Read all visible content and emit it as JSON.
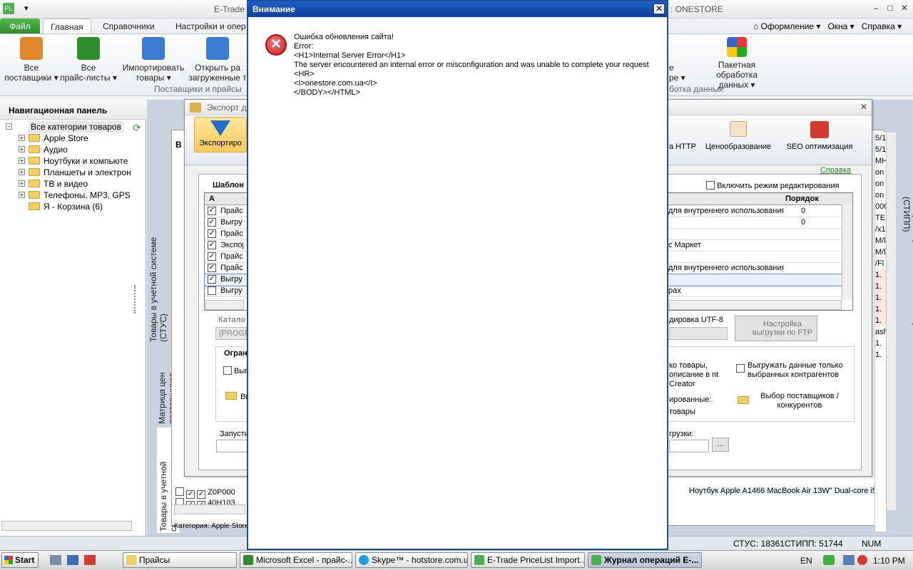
{
  "app": {
    "title_left": "E-Trade P",
    "title_right": ": ONESTORE",
    "win_min": "–",
    "win_max": "□",
    "win_close": "✕"
  },
  "ribbon": {
    "file_tab": "Файл",
    "tabs": [
      "Главная",
      "Справочники",
      "Настройки и опер"
    ],
    "right_menu": [
      "Оформление",
      "Окна",
      "Справка"
    ],
    "buttons": [
      {
        "label1": "Все",
        "label2": "поставщики ▾",
        "icon": "truck-icon",
        "color": "#e0862a"
      },
      {
        "label1": "Все",
        "label2": "прайс-листы ▾",
        "icon": "excel-icon",
        "color": "#2f8b2b"
      },
      {
        "label1": "Импортировать",
        "label2": "товары ▾",
        "icon": "import-icon",
        "color": "#3a7bd5"
      },
      {
        "label1": "Открыть ра",
        "label2": "загруженные т",
        "icon": "open-import-icon",
        "color": "#3a7bd5"
      }
    ],
    "group_left": "Поставщики и прайсы",
    "right_buttons": [
      {
        "label1": "е",
        "label2": "ре ▾"
      },
      {
        "label1": "Пакетная",
        "label2": "обработка данных ▾",
        "icon": "rubik-cube-icon"
      }
    ],
    "group_right": "ботка данных"
  },
  "nav": {
    "title": "Навигационная панель",
    "root": "Все категории товаров",
    "items": [
      "Apple Store",
      "Аудио",
      "Ноутбуки и компьюте",
      "Планшеты и электрон",
      "ТВ и видео",
      "Телефоны, MP3, GPS",
      "Я - Корзина (6)"
    ]
  },
  "side_tabs": {
    "left1": "Товары в учетной системе (СТУС)",
    "left2": "Матрица цен поставщиков",
    "left3": "Товары в учетной системе",
    "right": "Товары в прайс-листах поставщиков (СТИПП)",
    "category": "Категория: Apple Store /"
  },
  "export_window": {
    "title": "Экспорт д",
    "export_btn": "Экспортиро",
    "tools": [
      "а HTTP",
      "Ценообразование",
      "SEO оптимизация"
    ],
    "help_link": "Справка",
    "templates_label": "Шаблон",
    "edit_mode": "Включить режим редактирования",
    "col_a": "А",
    "col_order": "Порядок",
    "rows_left": [
      "Прайс",
      "Выгру",
      "Прайс",
      "Экспор",
      "Прайс",
      "Прайс",
      "Выгру",
      "Выгру"
    ],
    "rows_right": [
      "для внутреннего использования",
      "",
      "",
      "с Маркет",
      "",
      "для внутреннего использования",
      "",
      "рах"
    ],
    "orders": [
      "0",
      "0"
    ],
    "catalog_label": "Катало",
    "catalog_value": "{PROGR",
    "encoding": "дировка UTF-8",
    "ftp_btn": "Настройка выгрузки по FTP",
    "limits_label": "Огран",
    "limit_opt1": "Выг выб",
    "limit_opt2": "Вы",
    "only_goods": "ко товары, описание в nt Creator",
    "formed": "ированные: товары",
    "only_selected": "Выгружать данные только выбранных контрагентов",
    "choose_suppliers": "Выбор поставщиков / конкурентов",
    "run_label": "Запусти",
    "upload_label": "грузки:",
    "browse": "..."
  },
  "grid_rows": [
    {
      "code": "Z0P000",
      "name": "Ноутбук Apple A1466 MacBook Air 13W\" Dual-core i5",
      "qty": "1."
    },
    {
      "code": "40H103",
      "name": "",
      "qty": ""
    }
  ],
  "right_col_values": [
    "5/1",
    "5/1",
    "МН",
    "on",
    "on",
    "on",
    "000",
    "ТЕ",
    "/х1",
    "M/l",
    "M/l",
    "/Fl",
    "1.",
    "1.",
    "1.",
    "1.",
    "1.",
    "ash",
    "1.",
    "1."
  ],
  "dialog": {
    "title": "Внимание",
    "close": "✕",
    "icon": "error-icon",
    "message": "Ошибка обновления сайта!\nError:\n<H1>Internal Server Error</H1>\nThe server encountered an internal error or misconfiguration and was unable to complete your request\n<HR>\n<I>onestore.com.ua</I>\n</BODY></HTML>"
  },
  "status": {
    "stus": "СТУС: 18361",
    "stipp": "СТИПП: 51744",
    "num": "NUM"
  },
  "taskbar": {
    "start": "Start",
    "items": [
      {
        "label": "Прайсы",
        "icon": "folder-icon",
        "color": "#f3cf62"
      },
      {
        "label": "Microsoft Excel - прайс-...",
        "icon": "excel-icon",
        "color": "#2f8b2b"
      },
      {
        "label": "Skype™ - hotstore.com.ua",
        "icon": "skype-icon",
        "color": "#1aa0e0"
      },
      {
        "label": "E-Trade PriceList Import...",
        "icon": "etrade-icon",
        "color": "#4caf50"
      },
      {
        "label": "Журнал операций E-...",
        "icon": "etrade-icon",
        "color": "#4caf50"
      }
    ],
    "lang": "EN",
    "clock": "1:10 PM"
  }
}
